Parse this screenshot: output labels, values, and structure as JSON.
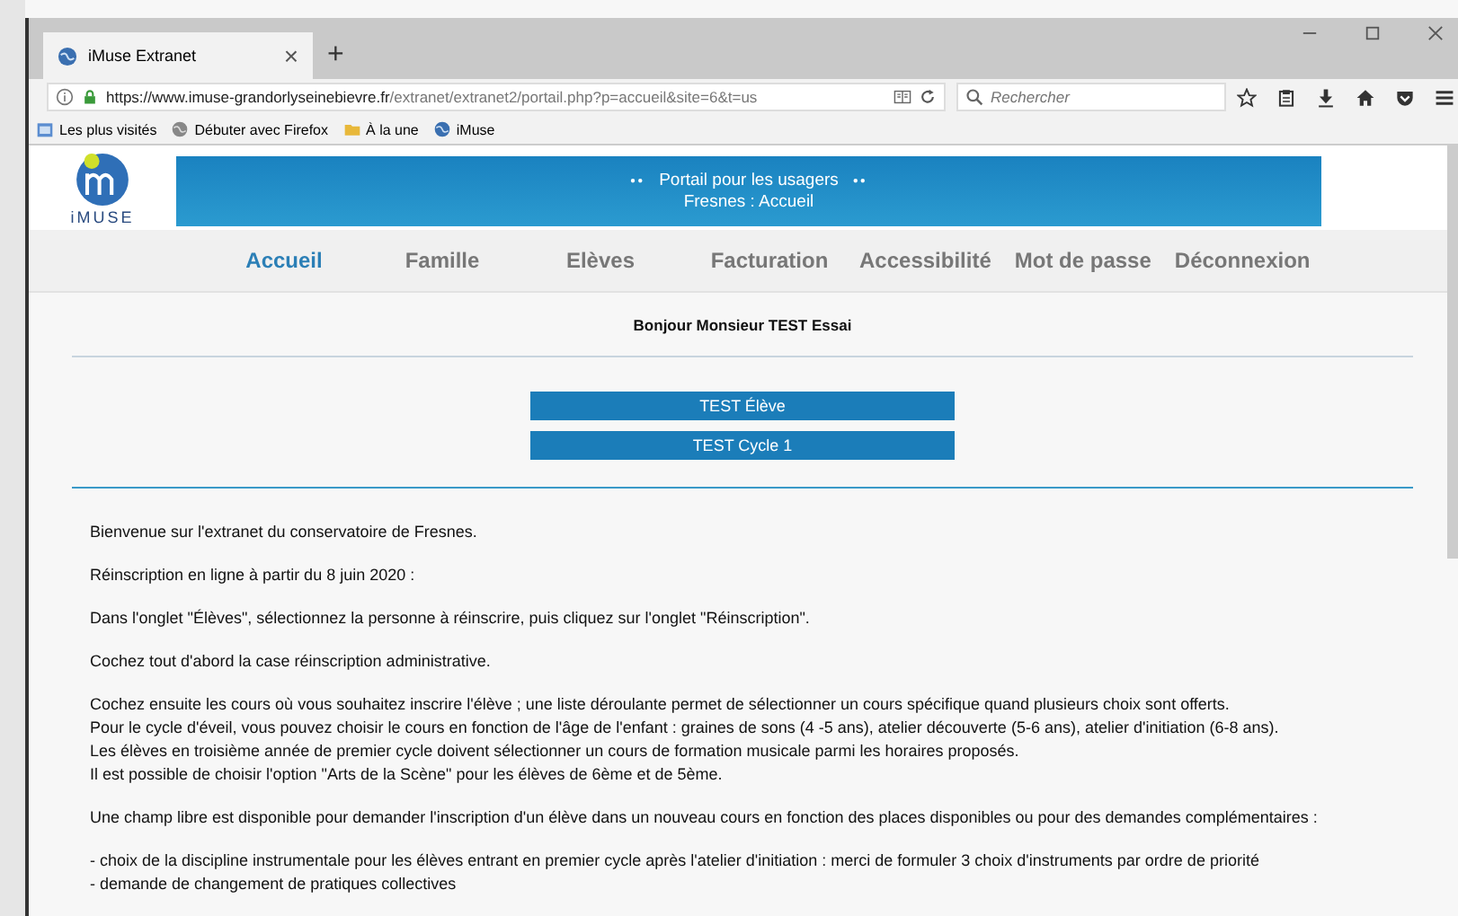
{
  "browser": {
    "tab_title": "iMuse Extranet",
    "new_tab": "+",
    "tab_close": "×",
    "url_host": "https://www.imuse-grandorlyseinebievre.fr",
    "url_path": "/extranet/extranet2/portail.php?p=accueil&site=6&t=us",
    "search": {
      "placeholder": "Rechercher"
    },
    "bookmarks": [
      "Les plus visités",
      "Débuter avec Firefox",
      "À la une",
      "iMuse"
    ]
  },
  "logo": {
    "text": "iMUSE"
  },
  "banner": {
    "line_1": "Portail pour les usagers",
    "line_2": "Fresnes : Accueil",
    "dots": "●●"
  },
  "nav": [
    {
      "label": "Accueil",
      "selected": true
    },
    {
      "label": "Famille",
      "selected": false
    },
    {
      "label": "Elèves",
      "selected": false
    },
    {
      "label": "Facturation",
      "selected": false
    },
    {
      "label": "Accessibilité",
      "selected": false
    },
    {
      "label": "Mot de passe",
      "selected": false
    },
    {
      "label": "Déconnexion",
      "selected": false
    }
  ],
  "greeting": "Bonjour Monsieur TEST Essai",
  "student_buttons": [
    "TEST Élève",
    "TEST Cycle 1"
  ],
  "paragraphs": [
    [
      "Bienvenue sur l'extranet du conservatoire de Fresnes."
    ],
    [
      "Réinscription en ligne à partir du 8 juin 2020 :"
    ],
    [
      "Dans l'onglet \"Élèves\", sélectionnez la personne à réinscrire, puis cliquez sur l'onglet \"Réinscription\"."
    ],
    [
      "Cochez tout d'abord la case réinscription administrative."
    ],
    [
      "Cochez ensuite les cours où vous souhaitez inscrire l'élève ; une liste déroulante permet de sélectionner un cours spécifique quand plusieurs choix sont offerts.",
      "Pour le cycle d'éveil, vous pouvez choisir le cours en fonction de l'âge de l'enfant : graines de sons (4 -5 ans), atelier découverte (5-6 ans), atelier d'initiation (6-8 ans).",
      "Les élèves en troisième année de premier cycle doivent sélectionner un cours de formation musicale parmi les horaires proposés.",
      "Il est possible de choisir l'option \"Arts de la Scène\" pour les élèves de 6ème et de 5ème."
    ],
    [
      "Une champ libre est disponible pour demander l'inscription d'un élève dans un nouveau cours en fonction des places disponibles ou pour des demandes complémentaires :"
    ],
    [
      "- choix de la discipline instrumentale pour les élèves entrant en premier cycle après l'atelier d'initiation : merci de formuler 3 choix d'instruments par ordre de priorité",
      "- demande de changement de pratiques collectives"
    ]
  ]
}
